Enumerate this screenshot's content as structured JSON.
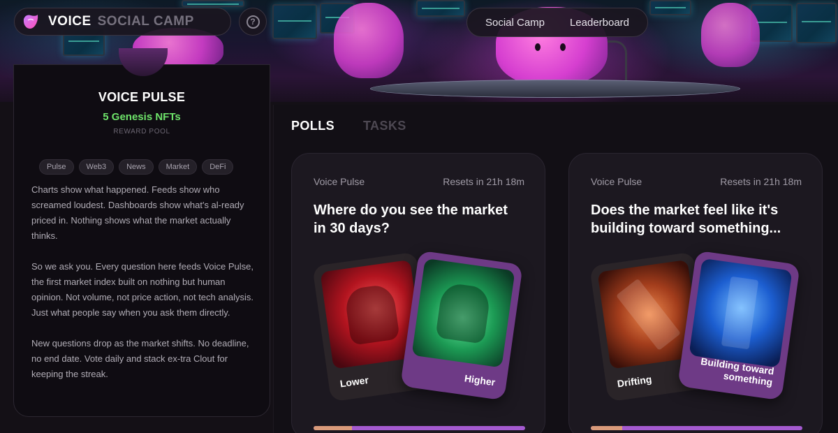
{
  "brand": {
    "name_primary": "VOICE",
    "name_secondary": "SOCIAL CAMP",
    "help_glyph": "?"
  },
  "nav": {
    "items": [
      "Social Camp",
      "Leaderboard"
    ]
  },
  "pulse_panel": {
    "title": "VOICE PULSE",
    "reward": "5 Genesis NFTs",
    "reward_label": "REWARD POOL",
    "tags": [
      "Pulse",
      "Web3",
      "News",
      "Market",
      "DeFi"
    ],
    "paragraphs": [
      "Charts show what happened. Feeds show who screamed loudest. Dashboards show what's al-ready priced in. Nothing shows what the market actually thinks.",
      "So we ask you. Every question here feeds Voice Pulse, the first market index built on nothing but human opinion. Not volume, not price action, not tech analysis. Just what people say when you ask them directly.",
      "New questions drop as the market shifts. No deadline, no end date. Vote daily and stack ex-tra Clout for keeping the streak."
    ]
  },
  "tabs": {
    "polls": "POLLS",
    "tasks": "TASKS"
  },
  "polls": [
    {
      "source": "Voice Pulse",
      "reset": "Resets in 21h 18m",
      "question": "Where do you see the market in 30 days?",
      "option_a": "Lower",
      "option_b": "Higher",
      "progress": 0.18
    },
    {
      "source": "Voice Pulse",
      "reset": "Resets in 21h 18m",
      "question": "Does the market feel like it's building toward something...",
      "option_a": "Drifting",
      "option_b": "Building toward something",
      "progress": 0.15
    }
  ],
  "colors": {
    "accent_purple": "#a45ad0",
    "reward_green": "#6ee36a",
    "background": "#141016"
  }
}
